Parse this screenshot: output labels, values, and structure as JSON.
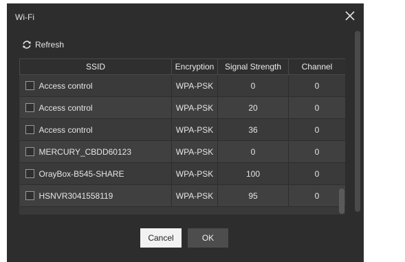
{
  "dialog": {
    "title": "Wi-Fi",
    "close_icon": "close-icon"
  },
  "toolbar": {
    "refresh_label": "Refresh",
    "refresh_icon": "refresh-icon"
  },
  "table": {
    "headers": [
      "SSID",
      "Encryption",
      "Signal Strength",
      "Channel"
    ],
    "rows": [
      {
        "ssid": "Access control",
        "encryption": "WPA-PSK",
        "signal": "0",
        "channel": "0"
      },
      {
        "ssid": "Access control",
        "encryption": "WPA-PSK",
        "signal": "20",
        "channel": "0"
      },
      {
        "ssid": "Access control",
        "encryption": "WPA-PSK",
        "signal": "36",
        "channel": "0"
      },
      {
        "ssid": "MERCURY_CBDD60123",
        "encryption": "WPA-PSK",
        "signal": "0",
        "channel": "0"
      },
      {
        "ssid": "OrayBox-B545-SHARE",
        "encryption": "WPA-PSK",
        "signal": "100",
        "channel": "0"
      },
      {
        "ssid": "HSNVR3041558119",
        "encryption": "WPA-PSK",
        "signal": "95",
        "channel": "0"
      }
    ]
  },
  "buttons": {
    "cancel_label": "Cancel",
    "ok_label": "OK"
  },
  "colors": {
    "dialog_bg": "#2d2d2d",
    "row_bg": "#3a3a3a",
    "header_bg": "#2f2f2f",
    "cancel_bg": "#f2f2f2",
    "ok_bg": "#4d4d4d"
  }
}
